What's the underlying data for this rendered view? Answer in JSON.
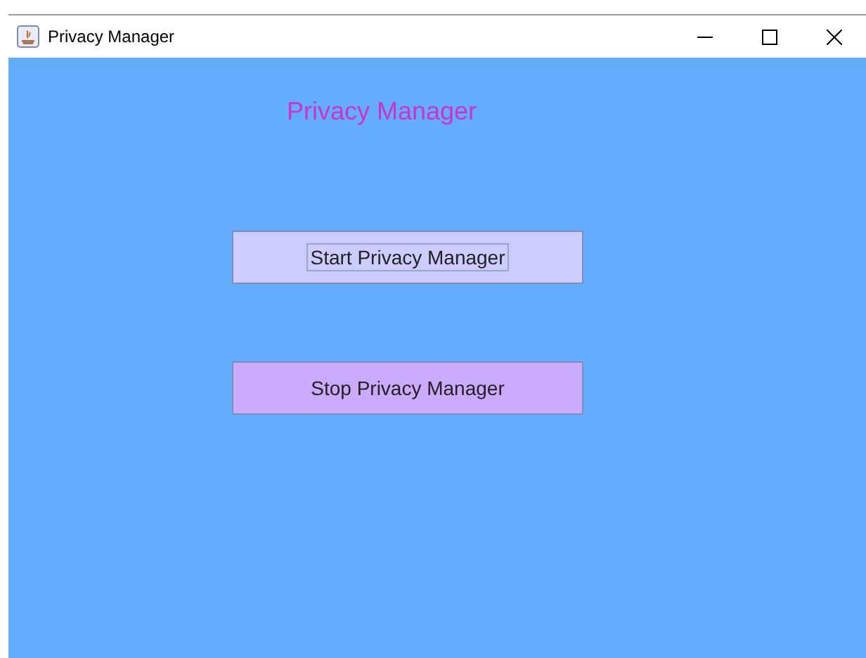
{
  "window": {
    "title": "Privacy Manager"
  },
  "heading": "Privacy Manager",
  "buttons": [
    {
      "label": "Start Privacy Manager",
      "color": "#ccccff",
      "focused": true
    },
    {
      "label": "Stop Privacy Manager",
      "color": "#ccaaff",
      "focused": false
    }
  ]
}
